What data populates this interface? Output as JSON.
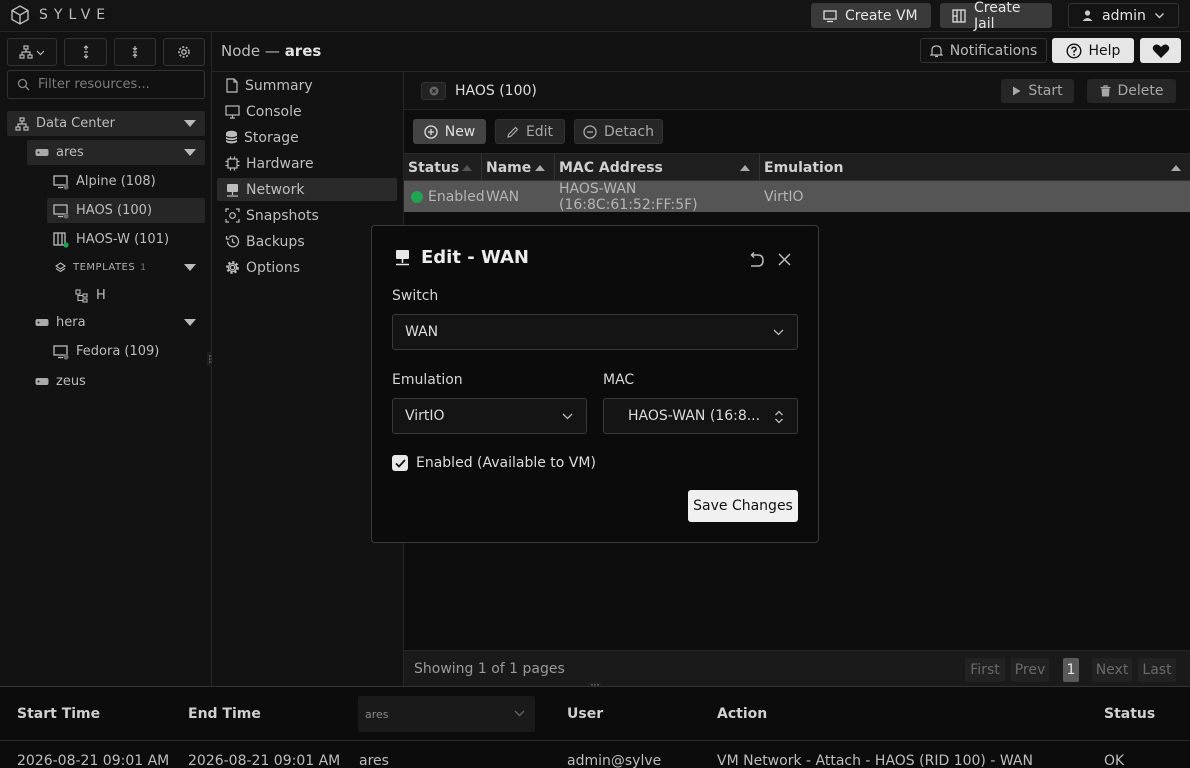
{
  "app": {
    "brand": "SYLVE"
  },
  "topbar": {
    "create_vm": "Create VM",
    "create_jail": "Create Jail",
    "user": "admin"
  },
  "sidebar": {
    "filter_placeholder": "Filter resources...",
    "datacenter": "Data Center",
    "nodes": [
      {
        "label": "ares",
        "children": [
          "Alpine (108)",
          "HAOS (100)",
          "HAOS-W (101)"
        ],
        "templates_label": "TEMPLATES",
        "templates_count": "1",
        "template_item": "H"
      },
      {
        "label": "hera",
        "children": [
          "Fedora (109)"
        ]
      },
      {
        "label": "zeus"
      }
    ]
  },
  "header": {
    "prefix": "Node — ",
    "node": "ares",
    "notifications": "Notifications",
    "help": "Help"
  },
  "subnav": [
    "Summary",
    "Console",
    "Storage",
    "Hardware",
    "Network",
    "Snapshots",
    "Backups",
    "Options"
  ],
  "vm": {
    "title": "HAOS (100)",
    "start": "Start",
    "delete": "Delete"
  },
  "toolbar": {
    "new": "New",
    "edit": "Edit",
    "detach": "Detach"
  },
  "table": {
    "headers": [
      "Status",
      "Name",
      "MAC Address",
      "Emulation"
    ],
    "rows": [
      {
        "status": "Enabled",
        "name": "WAN",
        "mac": "HAOS-WAN (16:8C:61:52:FF:5F)",
        "emulation": "VirtIO"
      }
    ]
  },
  "pager": {
    "info": "Showing 1 of 1 pages",
    "first": "First",
    "prev": "Prev",
    "page": "1",
    "next": "Next",
    "last": "Last"
  },
  "log": {
    "headers": [
      "Start Time",
      "End Time",
      "User",
      "Action",
      "Status"
    ],
    "node_filter": "ares",
    "row": {
      "start": "2026-08-21 09:01 AM",
      "end": "2026-08-21 09:01 AM",
      "node": "ares",
      "user": "admin@sylve",
      "action": "VM Network - Attach - HAOS (RID 100) - WAN",
      "status": "OK"
    }
  },
  "modal": {
    "title": "Edit - WAN",
    "switch_label": "Switch",
    "switch_value": "WAN",
    "emulation_label": "Emulation",
    "emulation_value": "VirtIO",
    "mac_label": "MAC",
    "mac_value": "HAOS-WAN (16:8...",
    "enabled_label": "Enabled (Available to VM)",
    "enabled": true,
    "save": "Save Changes"
  },
  "colors": {
    "status_enabled": "#22a34f",
    "selected_row": "#555555",
    "save_button": "#f0f0f0"
  }
}
